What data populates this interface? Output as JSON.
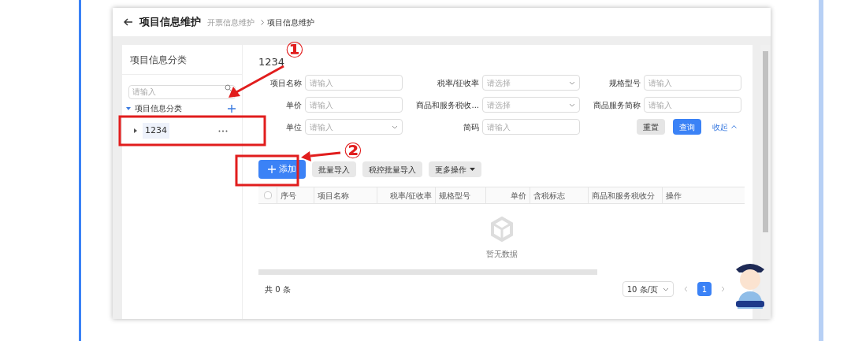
{
  "header": {
    "title": "项目信息维护",
    "breadcrumb": [
      "开票信息维护",
      "项目信息维护"
    ]
  },
  "sidebar": {
    "title": "项目信息分类",
    "search": {
      "placeholder": "请输入"
    },
    "tree": [
      {
        "label": "项目信息分类",
        "expanded": true,
        "children": [
          {
            "label": "1234",
            "expanded": false,
            "selected": true
          }
        ]
      }
    ]
  },
  "main": {
    "title": "1234",
    "filters": [
      {
        "label": "项目名称",
        "kind": "input",
        "placeholder": "请输入"
      },
      {
        "label": "税率/征收率",
        "kind": "select",
        "placeholder": "请选择"
      },
      {
        "label": "规格型号",
        "kind": "input",
        "placeholder": "请输入"
      },
      {
        "label": "单价",
        "kind": "input",
        "placeholder": "请输入"
      },
      {
        "label": "商品和服务税收...",
        "kind": "select",
        "placeholder": "请选择"
      },
      {
        "label": "商品服务简称",
        "kind": "input",
        "placeholder": "请输入"
      },
      {
        "label": "单位",
        "kind": "select",
        "placeholder": "请输入"
      },
      {
        "label": "简码",
        "kind": "input",
        "placeholder": "请输入"
      }
    ],
    "actions": [
      {
        "label": "重置",
        "kind": "default"
      },
      {
        "label": "查询",
        "kind": "primary"
      }
    ],
    "collapse_link": "收起"
  },
  "toolbar": [
    {
      "label": "添加",
      "kind": "primary"
    },
    {
      "label": "批量导入",
      "kind": "default"
    },
    {
      "label": "税控批量导入",
      "kind": "default"
    },
    {
      "label": "更多操作",
      "kind": "dropdown"
    }
  ],
  "table": {
    "checked": false,
    "columns": [
      {
        "label": "序号"
      },
      {
        "label": "项目名称"
      },
      {
        "label": "税率/征收率"
      },
      {
        "label": "规格型号"
      },
      {
        "label": "单价"
      },
      {
        "label": "含税标志"
      },
      {
        "label": "商品和服务税收分"
      },
      {
        "label": "操作"
      }
    ],
    "empty_text": "暂无数据"
  },
  "pagination": {
    "total": "共 0 条",
    "page_size": "10 条/页",
    "pages": [
      {
        "label": "1",
        "selected": true
      }
    ]
  },
  "annotations": [
    {
      "label": "①"
    },
    {
      "label": "②"
    }
  ]
}
